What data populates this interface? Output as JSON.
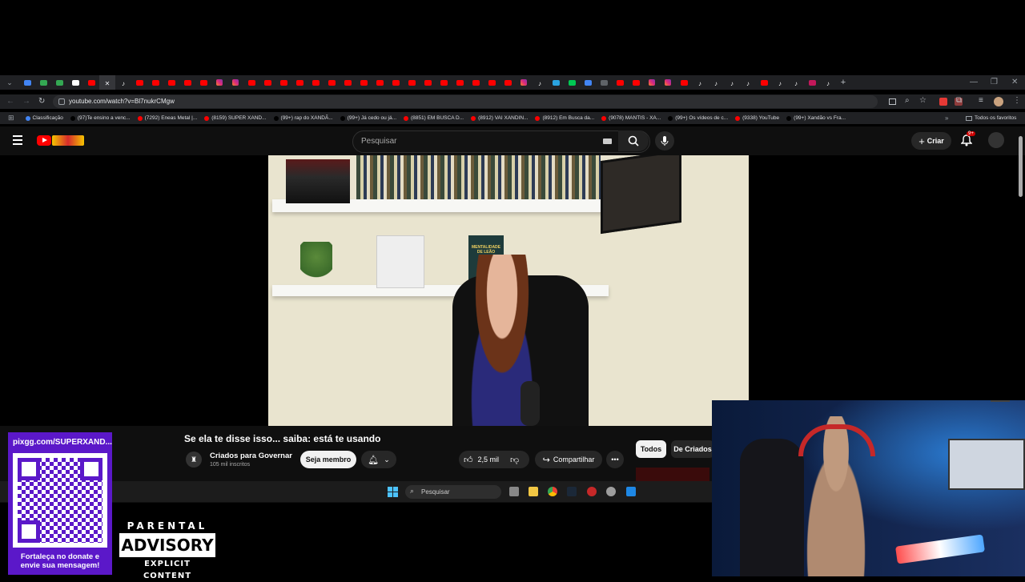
{
  "browser": {
    "tab_favicons": [
      "#4285f4",
      "#34a853",
      "#34a853",
      "#ffffff",
      "#ff0000",
      "close",
      "tiktok",
      "#ff0000",
      "#ff0000",
      "#ff0000",
      "#ff0000",
      "#ff0000",
      "instagram",
      "instagram",
      "#ff0000",
      "#ff0000",
      "#ff0000",
      "#ff0000",
      "#ff0000",
      "#ff0000",
      "#ff0000",
      "#ff0000",
      "#ff0000",
      "#ff0000",
      "#ff0000",
      "#ff0000",
      "#ff0000",
      "#ff0000",
      "#ff0000",
      "#ff0000",
      "#ff0000",
      "instagram",
      "tiktok",
      "#2aa3e0",
      "#00c853",
      "#4285f4",
      "#5f6368",
      "#ff0000",
      "#ff0000",
      "instagram",
      "instagram",
      "#ff0000",
      "tiktok",
      "tiktok",
      "tiktok",
      "tiktok",
      "#ff0000",
      "tiktok",
      "tiktok",
      "#c2185b",
      "tiktok"
    ],
    "url": "youtube.com/watch?v=Bl7nukrCMgw",
    "bookmarks": [
      {
        "label": "Classificação",
        "color": "#4285f4"
      },
      {
        "label": "(97)Te ensino a venc...",
        "color": "#000000"
      },
      {
        "label": "(7292) Eneas Metal |...",
        "color": "#ff0000"
      },
      {
        "label": "(8159) SUPER XAND...",
        "color": "#ff0000"
      },
      {
        "label": "(99+) rap do XANDÃ...",
        "color": "#000000"
      },
      {
        "label": "(99+) Já cedo ou já...",
        "color": "#000000"
      },
      {
        "label": "(8851) EM BUSCA D...",
        "color": "#ff0000"
      },
      {
        "label": "(8912) VAI XANDIN...",
        "color": "#ff0000"
      },
      {
        "label": "(8912) Em Busca da...",
        "color": "#ff0000"
      },
      {
        "label": "(9078) MANTIS - XA...",
        "color": "#ff0000"
      },
      {
        "label": "(99+) Os vídeos de c...",
        "color": "#000000"
      },
      {
        "label": "(9338) YouTube",
        "color": "#ff0000"
      },
      {
        "label": "(99+) Xandão vs Fra...",
        "color": "#000000"
      }
    ],
    "all_bookmarks": "Todos os favoritos"
  },
  "youtube": {
    "search_placeholder": "Pesquisar",
    "create_label": "Criar",
    "notif_badge": "9+",
    "video_title": "Se ela te disse isso... saiba: está te usando",
    "channel_name": "Criados para Governar",
    "subscribers": "105 mil inscritos",
    "member_button": "Seja membro",
    "likes": "2,5 mil",
    "share_label": "Compartilhar",
    "chip_all": "Todos",
    "chip_creator": "De Criados",
    "book_text": "MENTALIDADE DE LEÃO"
  },
  "taskbar": {
    "search_placeholder": "Pesquisar"
  },
  "overlay": {
    "qr_url": "pixgg.com/SUPERXAND...",
    "qr_caption": "Fortaleça no donate e envie sua mensagem!",
    "advisory_top": "PARENTAL",
    "advisory_mid": "ADVISORY",
    "advisory_bottom": "EXPLICIT CONTENT"
  },
  "colors": {
    "youtube_red": "#ff0000",
    "youtube_bg": "#0f0f0f",
    "qr_purple": "#5b18c9"
  }
}
